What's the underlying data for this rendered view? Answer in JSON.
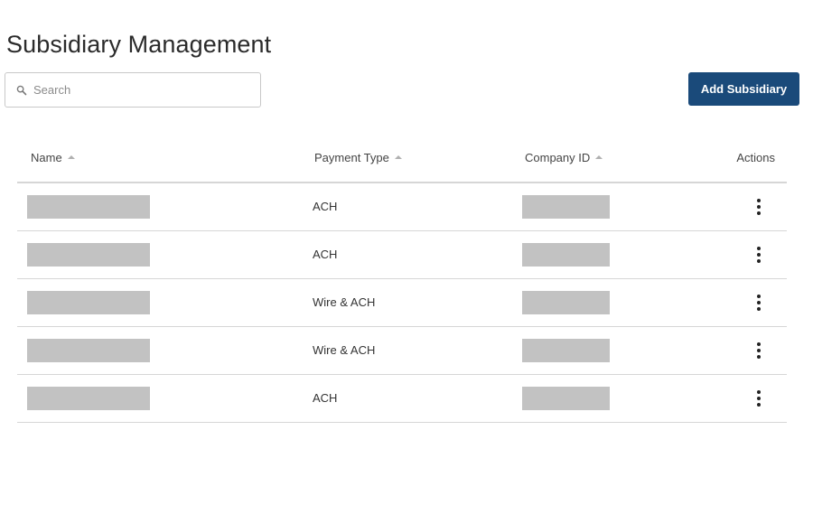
{
  "page": {
    "title": "Subsidiary Management"
  },
  "search": {
    "placeholder": "Search",
    "value": "",
    "icon": "search-icon"
  },
  "toolbar": {
    "add_label": "Add Subsidiary",
    "add_color": "#1a4a7a"
  },
  "table": {
    "columns": [
      {
        "label": "Name",
        "sortable": true
      },
      {
        "label": "Payment Type",
        "sortable": true
      },
      {
        "label": "Company ID",
        "sortable": true
      },
      {
        "label": "Actions",
        "sortable": false
      }
    ],
    "rows": [
      {
        "name": "",
        "payment_type": "ACH",
        "company_id": "",
        "name_redacted": true,
        "company_id_redacted": true
      },
      {
        "name": "",
        "payment_type": "ACH",
        "company_id": "",
        "name_redacted": true,
        "company_id_redacted": true
      },
      {
        "name": "",
        "payment_type": "Wire & ACH",
        "company_id": "",
        "name_redacted": true,
        "company_id_redacted": true
      },
      {
        "name": "",
        "payment_type": "Wire & ACH",
        "company_id": "",
        "name_redacted": true,
        "company_id_redacted": true
      },
      {
        "name": "",
        "payment_type": "ACH",
        "company_id": "",
        "name_redacted": true,
        "company_id_redacted": true
      }
    ],
    "row_action_icon": "more-vertical-icon"
  }
}
